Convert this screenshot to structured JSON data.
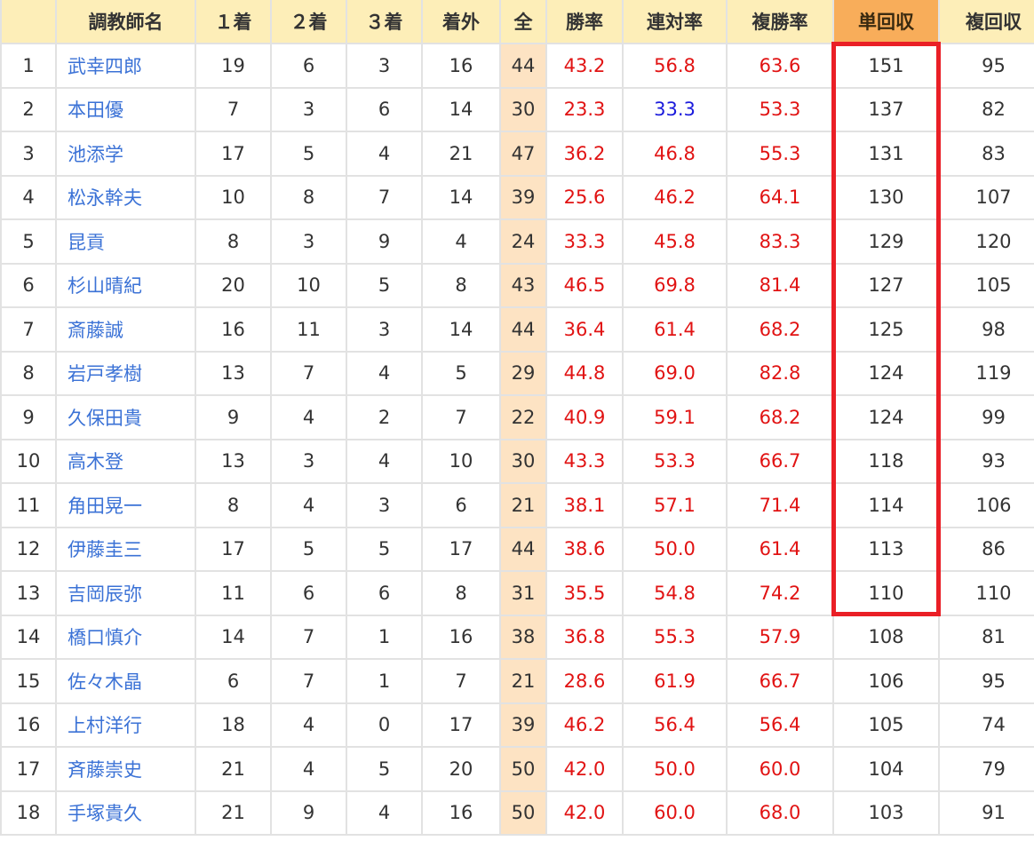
{
  "headers": [
    "",
    "調教師名",
    "１着",
    "２着",
    "３着",
    "着外",
    "全",
    "勝率",
    "連対率",
    "複勝率",
    "単回収",
    "複回収"
  ],
  "rows": [
    {
      "rank": "1",
      "name": "武幸四郎",
      "first": "19",
      "second": "6",
      "third": "3",
      "out": "16",
      "total": "44",
      "win_rate": "43.2",
      "place_rate": "56.8",
      "show_rate": "63.6",
      "win_return": "151",
      "show_return": "95"
    },
    {
      "rank": "2",
      "name": "本田優",
      "first": "7",
      "second": "3",
      "third": "6",
      "out": "14",
      "total": "30",
      "win_rate": "23.3",
      "place_rate": "33.3",
      "show_rate": "53.3",
      "win_return": "137",
      "show_return": "82"
    },
    {
      "rank": "3",
      "name": "池添学",
      "first": "17",
      "second": "5",
      "third": "4",
      "out": "21",
      "total": "47",
      "win_rate": "36.2",
      "place_rate": "46.8",
      "show_rate": "55.3",
      "win_return": "131",
      "show_return": "83"
    },
    {
      "rank": "4",
      "name": "松永幹夫",
      "first": "10",
      "second": "8",
      "third": "7",
      "out": "14",
      "total": "39",
      "win_rate": "25.6",
      "place_rate": "46.2",
      "show_rate": "64.1",
      "win_return": "130",
      "show_return": "107"
    },
    {
      "rank": "5",
      "name": "昆貢",
      "first": "8",
      "second": "3",
      "third": "9",
      "out": "4",
      "total": "24",
      "win_rate": "33.3",
      "place_rate": "45.8",
      "show_rate": "83.3",
      "win_return": "129",
      "show_return": "120"
    },
    {
      "rank": "6",
      "name": "杉山晴紀",
      "first": "20",
      "second": "10",
      "third": "5",
      "out": "8",
      "total": "43",
      "win_rate": "46.5",
      "place_rate": "69.8",
      "show_rate": "81.4",
      "win_return": "127",
      "show_return": "105"
    },
    {
      "rank": "7",
      "name": "斎藤誠",
      "first": "16",
      "second": "11",
      "third": "3",
      "out": "14",
      "total": "44",
      "win_rate": "36.4",
      "place_rate": "61.4",
      "show_rate": "68.2",
      "win_return": "125",
      "show_return": "98"
    },
    {
      "rank": "8",
      "name": "岩戸孝樹",
      "first": "13",
      "second": "7",
      "third": "4",
      "out": "5",
      "total": "29",
      "win_rate": "44.8",
      "place_rate": "69.0",
      "show_rate": "82.8",
      "win_return": "124",
      "show_return": "119"
    },
    {
      "rank": "9",
      "name": "久保田貴",
      "first": "9",
      "second": "4",
      "third": "2",
      "out": "7",
      "total": "22",
      "win_rate": "40.9",
      "place_rate": "59.1",
      "show_rate": "68.2",
      "win_return": "124",
      "show_return": "99"
    },
    {
      "rank": "10",
      "name": "高木登",
      "first": "13",
      "second": "3",
      "third": "4",
      "out": "10",
      "total": "30",
      "win_rate": "43.3",
      "place_rate": "53.3",
      "show_rate": "66.7",
      "win_return": "118",
      "show_return": "93"
    },
    {
      "rank": "11",
      "name": "角田晃一",
      "first": "8",
      "second": "4",
      "third": "3",
      "out": "6",
      "total": "21",
      "win_rate": "38.1",
      "place_rate": "57.1",
      "show_rate": "71.4",
      "win_return": "114",
      "show_return": "106"
    },
    {
      "rank": "12",
      "name": "伊藤圭三",
      "first": "17",
      "second": "5",
      "third": "5",
      "out": "17",
      "total": "44",
      "win_rate": "38.6",
      "place_rate": "50.0",
      "show_rate": "61.4",
      "win_return": "113",
      "show_return": "86"
    },
    {
      "rank": "13",
      "name": "吉岡辰弥",
      "first": "11",
      "second": "6",
      "third": "6",
      "out": "8",
      "total": "31",
      "win_rate": "35.5",
      "place_rate": "54.8",
      "show_rate": "74.2",
      "win_return": "110",
      "show_return": "110"
    },
    {
      "rank": "14",
      "name": "橋口慎介",
      "first": "14",
      "second": "7",
      "third": "1",
      "out": "16",
      "total": "38",
      "win_rate": "36.8",
      "place_rate": "55.3",
      "show_rate": "57.9",
      "win_return": "108",
      "show_return": "81"
    },
    {
      "rank": "15",
      "name": "佐々木晶",
      "first": "6",
      "second": "7",
      "third": "1",
      "out": "7",
      "total": "21",
      "win_rate": "28.6",
      "place_rate": "61.9",
      "show_rate": "66.7",
      "win_return": "106",
      "show_return": "95"
    },
    {
      "rank": "16",
      "name": "上村洋行",
      "first": "18",
      "second": "4",
      "third": "0",
      "out": "17",
      "total": "39",
      "win_rate": "46.2",
      "place_rate": "56.4",
      "show_rate": "56.4",
      "win_return": "105",
      "show_return": "74"
    },
    {
      "rank": "17",
      "name": "斉藤崇史",
      "first": "21",
      "second": "4",
      "third": "5",
      "out": "20",
      "total": "50",
      "win_rate": "42.0",
      "place_rate": "50.0",
      "show_rate": "60.0",
      "win_return": "104",
      "show_return": "79"
    },
    {
      "rank": "18",
      "name": "手塚貴久",
      "first": "21",
      "second": "9",
      "third": "4",
      "out": "16",
      "total": "50",
      "win_rate": "42.0",
      "place_rate": "60.0",
      "show_rate": "68.0",
      "win_return": "103",
      "show_return": "91"
    }
  ],
  "colors": {
    "header_bg": "#fdeeb8",
    "highlight_header_bg": "#f8ad5a",
    "total_column_bg": "#fde3c3",
    "name_link": "#3b72d6",
    "rate_red": "#e11313",
    "rate_blue": "#1b1bdc",
    "highlight_box": "#ea1f26"
  },
  "highlight": {
    "column": "単回収",
    "from_rank": "1",
    "to_rank": "13"
  }
}
